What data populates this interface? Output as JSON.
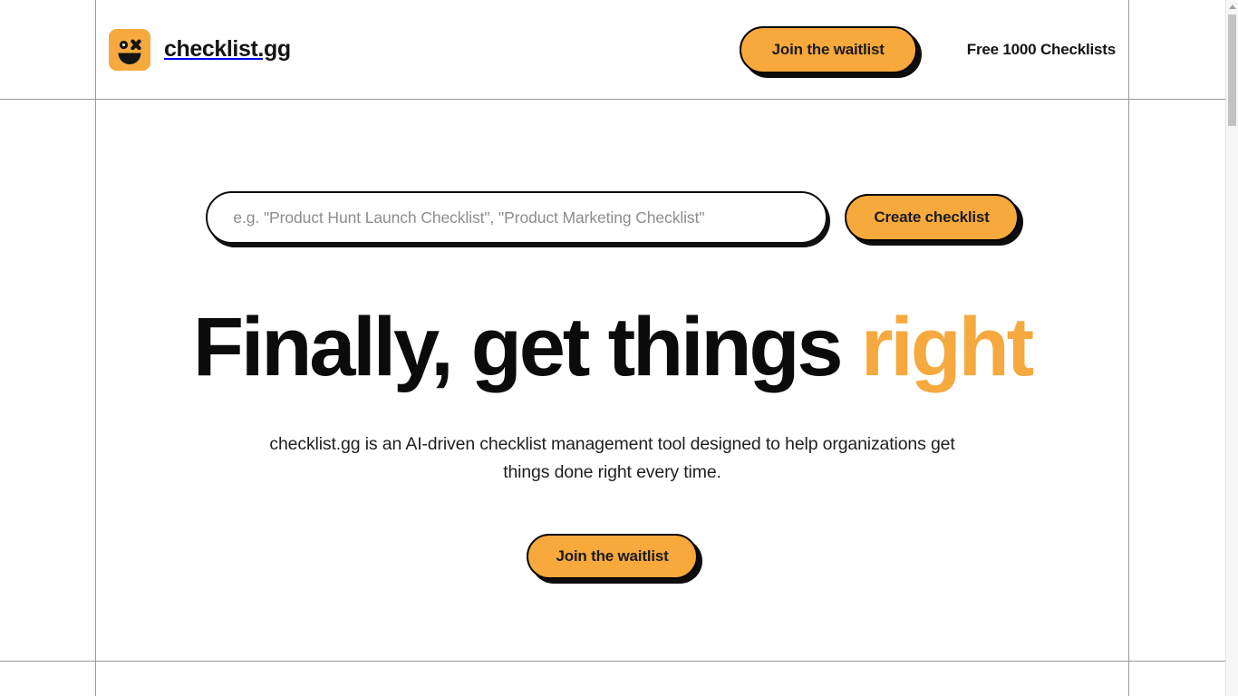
{
  "brand": {
    "name": "checklist.gg",
    "logo_icon": "smiley-face-icon",
    "logo_colors": {
      "background": "#F5A93F",
      "features": "#141414"
    }
  },
  "header": {
    "waitlist_button": "Join the waitlist",
    "note": "Free 1000 Checklists"
  },
  "hero": {
    "search": {
      "placeholder": "e.g. \"Product Hunt Launch Checklist\", \"Product Marketing Checklist\"",
      "value": ""
    },
    "create_button": "Create checklist",
    "headline_part1": "Finally, get things ",
    "headline_accent": "right",
    "subtitle": "checklist.gg is an AI-driven checklist management tool designed to help organizations get things done right every time.",
    "cta_button": "Join the waitlist"
  },
  "theme": {
    "accent": "#F5A93F",
    "button_fill": "#F7A93C",
    "outline": "#0d0d0d",
    "text": "#141414",
    "placeholder_text": "#8d8d8d",
    "grid_line": "#9a9a9a"
  },
  "scrollbar": {
    "up_arrow_icon": "chevron-up-icon",
    "thumb_position_percent": 2
  }
}
